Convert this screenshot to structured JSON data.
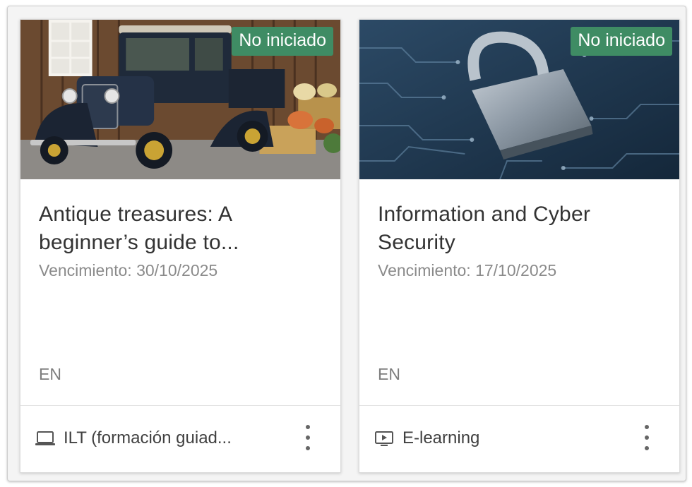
{
  "courses": [
    {
      "status_badge": "No iniciado",
      "title": "Antique treasures: A beginner’s guide to...",
      "due": "Vencimiento: 30/10/2025",
      "language": "EN",
      "type_label": "ILT (formación guiad...",
      "type_icon": "laptop-icon",
      "image": "antique-truck-photo"
    },
    {
      "status_badge": "No iniciado",
      "title": "Information and Cyber Security",
      "due": "Vencimiento: 17/10/2025",
      "language": "EN",
      "type_label": "E-learning",
      "type_icon": "video-play-icon",
      "image": "padlock-circuit-photo"
    }
  ],
  "colors": {
    "badge_bg": "#3f8c64",
    "title": "#333333",
    "muted": "#8a8a8a"
  }
}
